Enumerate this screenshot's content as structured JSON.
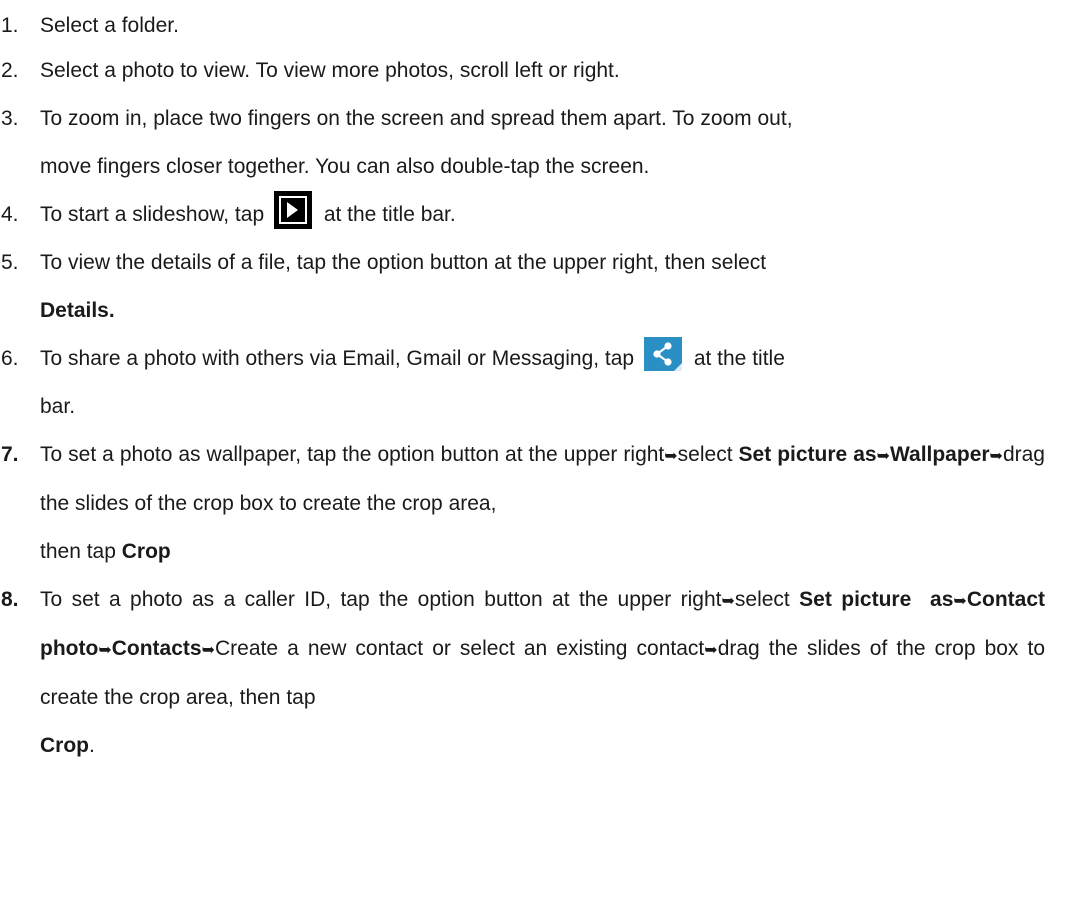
{
  "steps": [
    {
      "num": "1.",
      "text": "Select a folder."
    },
    {
      "num": "2.",
      "text": "Select a photo to view. To view more photos, scroll left or right."
    },
    {
      "num": "3.",
      "line1": "To zoom in, place two fingers on the screen and spread them apart. To zoom out,",
      "line2": "move fingers closer together. You can also double-tap the screen."
    },
    {
      "num": "4.",
      "before": "To start a slideshow, tap",
      "after": "at the title bar.",
      "icon": "slideshow-icon"
    },
    {
      "num": "5.",
      "line1": "To view the details of a file, tap the option button at the upper right, then select",
      "bold": "Details."
    },
    {
      "num": "6.",
      "before": "To share a photo with others via Email, Gmail or Messaging, tap",
      "after": "at the title",
      "line2": "bar.",
      "icon": "share-icon"
    },
    {
      "num": "7.",
      "t1": "To set a photo as wallpaper, tap the option button at the upper right",
      "t2": "select ",
      "b1": "Set picture as",
      "b2": "Wallpaper",
      "t3": "drag the slides of the crop box to create the crop area,",
      "t4": "then tap ",
      "b3": "Crop"
    },
    {
      "num": "8.",
      "t1": "To set a photo as a caller ID, tap the option button at the upper right",
      "t2": "select ",
      "b1": "Set picture  as",
      "b2": "Contact photo",
      "b3": "Contacts",
      "t3": "Create a new contact or select an existing contact",
      "t4": "drag the slides of the crop box to create the crop area, then tap",
      "b4": "Crop",
      "t5": "."
    }
  ],
  "arrow": "➥",
  "colors": {
    "text": "#1a1a1a",
    "share_icon_bg": "#2a8fc4",
    "slideshow_icon_bg": "#000000"
  }
}
